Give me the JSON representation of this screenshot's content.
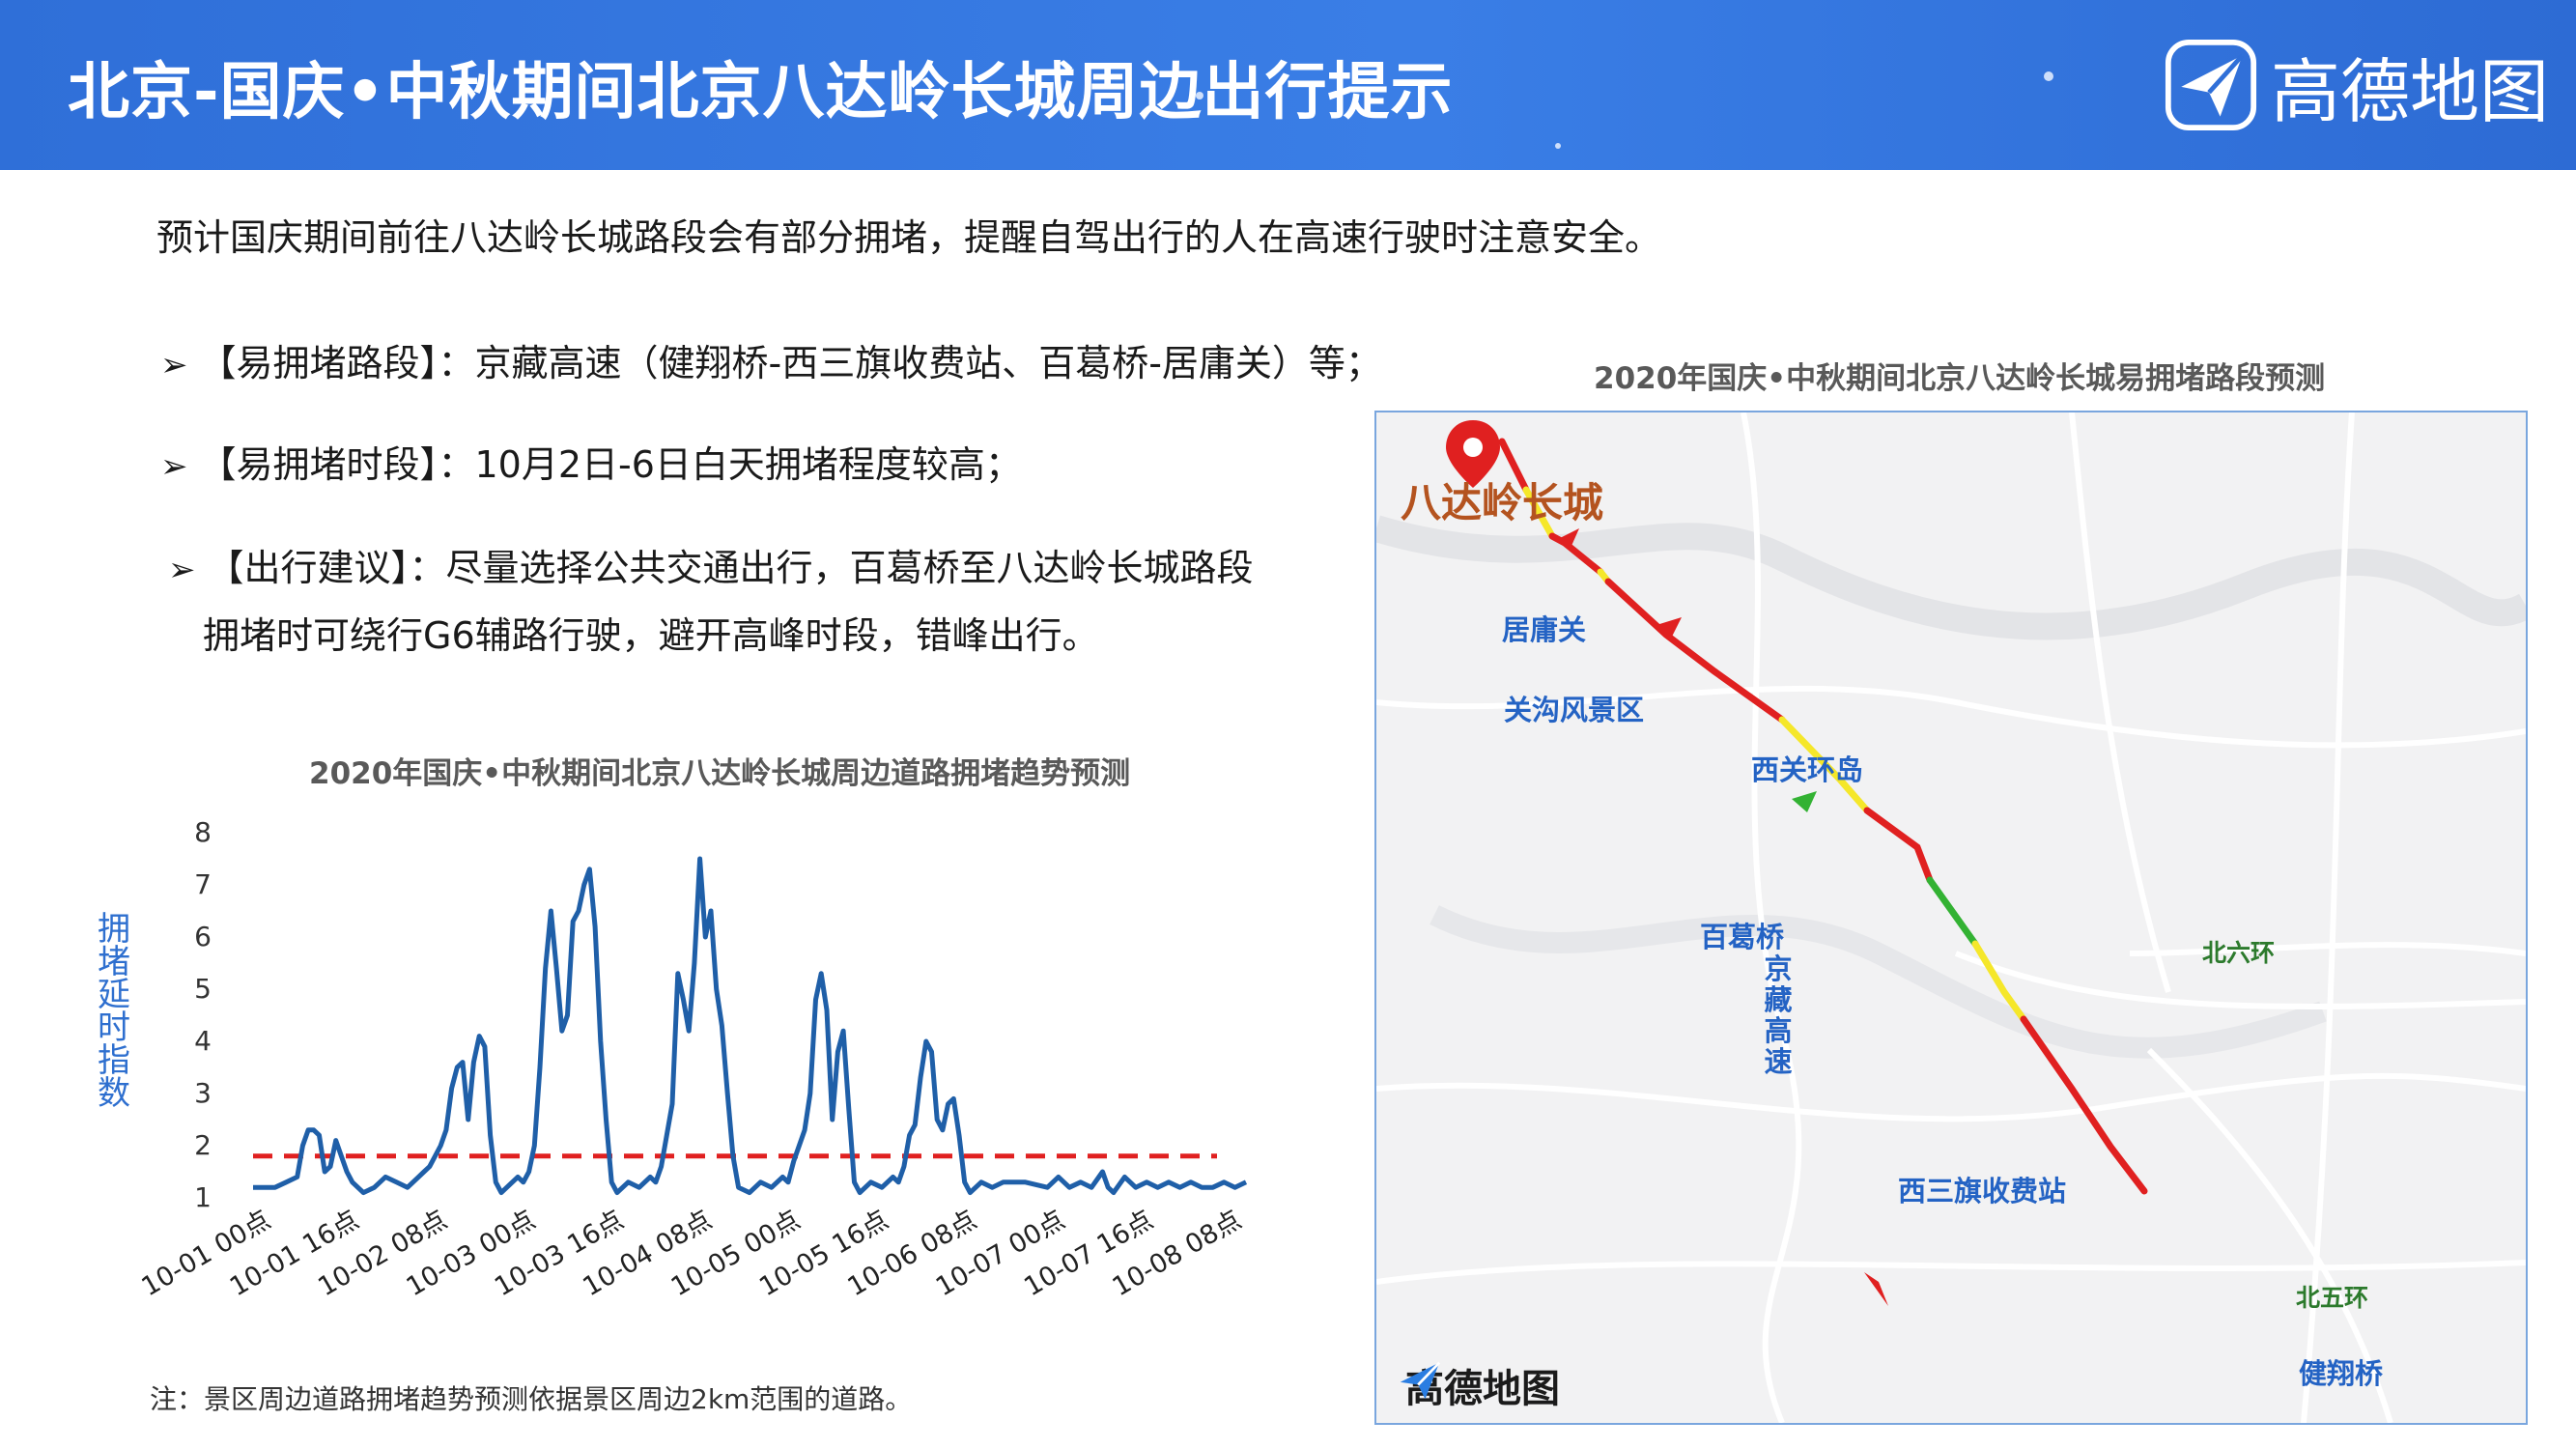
{
  "header": {
    "title": "北京-国庆•中秋期间北京八达岭长城周边出行提示",
    "brand": "高德地图",
    "brand_icon": "gaode-paper-plane-icon"
  },
  "intro": "预计国庆期间前往八达岭长城路段会有部分拥堵，提醒自驾出行的人在高速行驶时注意安全。",
  "bullets": [
    {
      "icon": "arrow-right-icon",
      "text": "【易拥堵路段】：京藏高速（健翔桥-西三旗收费站、百葛桥-居庸关）等；"
    },
    {
      "icon": "arrow-right-icon",
      "text": "【易拥堵时段】：10月2日-6日白天拥堵程度较高；"
    },
    {
      "icon": "arrow-right-icon",
      "text": "【出行建议】：尽量选择公共交通出行，百葛桥至八达岭长城路段",
      "text_cont": "拥堵时可绕行G6辅路行驶，避开高峰时段，错峰出行。"
    }
  ],
  "chart_title": "2020年国庆•中秋期间北京八达岭长城周边道路拥堵趋势预测",
  "chart_ylabel": [
    "拥",
    "堵",
    "延",
    "时",
    "指",
    "数"
  ],
  "chart_data": {
    "type": "line",
    "title": "2020年国庆•中秋期间北京八达岭长城周边道路拥堵趋势预测",
    "ylabel": "拥堵延时指数",
    "xlabel": "",
    "ylim": [
      1,
      8
    ],
    "yticks": [
      1,
      2,
      3,
      4,
      5,
      6,
      7,
      8
    ],
    "xlim": [
      0,
      180
    ],
    "x_tick_labels": [
      "10-01 00点",
      "10-01 16点",
      "10-02 08点",
      "10-03 00点",
      "10-03 16点",
      "10-04 08点",
      "10-05 00点",
      "10-05 16点",
      "10-06 08点",
      "10-07 00点",
      "10-07 16点",
      "10-08 08点"
    ],
    "x_tick_hours": [
      0,
      16,
      32,
      48,
      64,
      80,
      96,
      112,
      128,
      144,
      160,
      176
    ],
    "grid": false,
    "reference_line": {
      "y": 1.8,
      "style": "dashed",
      "color": "#e02020"
    },
    "series": [
      {
        "color": "#1f5fa8",
        "points": [
          [
            0,
            1.2
          ],
          [
            4,
            1.2
          ],
          [
            6,
            1.3
          ],
          [
            8,
            1.4
          ],
          [
            9,
            2.0
          ],
          [
            10,
            2.3
          ],
          [
            11,
            2.3
          ],
          [
            12,
            2.2
          ],
          [
            13,
            1.5
          ],
          [
            14,
            1.6
          ],
          [
            15,
            2.1
          ],
          [
            16,
            1.8
          ],
          [
            17,
            1.5
          ],
          [
            18,
            1.3
          ],
          [
            20,
            1.1
          ],
          [
            22,
            1.2
          ],
          [
            24,
            1.4
          ],
          [
            26,
            1.3
          ],
          [
            28,
            1.2
          ],
          [
            30,
            1.4
          ],
          [
            31,
            1.5
          ],
          [
            32,
            1.6
          ],
          [
            34,
            2.0
          ],
          [
            35,
            2.3
          ],
          [
            36,
            3.1
          ],
          [
            37,
            3.5
          ],
          [
            38,
            3.6
          ],
          [
            39,
            2.5
          ],
          [
            40,
            3.6
          ],
          [
            41,
            4.1
          ],
          [
            42,
            3.9
          ],
          [
            43,
            2.2
          ],
          [
            44,
            1.3
          ],
          [
            45,
            1.1
          ],
          [
            46,
            1.2
          ],
          [
            48,
            1.4
          ],
          [
            49,
            1.3
          ],
          [
            50,
            1.5
          ],
          [
            51,
            2.0
          ],
          [
            52,
            3.5
          ],
          [
            53,
            5.4
          ],
          [
            54,
            6.5
          ],
          [
            55,
            5.4
          ],
          [
            56,
            4.2
          ],
          [
            57,
            4.5
          ],
          [
            58,
            6.3
          ],
          [
            59,
            6.5
          ],
          [
            60,
            7.0
          ],
          [
            61,
            7.3
          ],
          [
            62,
            6.2
          ],
          [
            63,
            4.0
          ],
          [
            64,
            2.5
          ],
          [
            65,
            1.3
          ],
          [
            66,
            1.1
          ],
          [
            68,
            1.3
          ],
          [
            70,
            1.2
          ],
          [
            72,
            1.4
          ],
          [
            73,
            1.3
          ],
          [
            74,
            1.6
          ],
          [
            75,
            2.2
          ],
          [
            76,
            2.8
          ],
          [
            77,
            5.3
          ],
          [
            78,
            4.8
          ],
          [
            79,
            4.2
          ],
          [
            80,
            5.5
          ],
          [
            81,
            7.5
          ],
          [
            82,
            6.0
          ],
          [
            83,
            6.5
          ],
          [
            84,
            5.0
          ],
          [
            85,
            4.3
          ],
          [
            86,
            3.0
          ],
          [
            87,
            1.8
          ],
          [
            88,
            1.2
          ],
          [
            90,
            1.1
          ],
          [
            92,
            1.3
          ],
          [
            94,
            1.2
          ],
          [
            96,
            1.4
          ],
          [
            97,
            1.3
          ],
          [
            98,
            1.7
          ],
          [
            99,
            2.0
          ],
          [
            100,
            2.3
          ],
          [
            101,
            3.0
          ],
          [
            102,
            4.8
          ],
          [
            103,
            5.3
          ],
          [
            104,
            4.6
          ],
          [
            105,
            2.5
          ],
          [
            106,
            3.8
          ],
          [
            107,
            4.2
          ],
          [
            108,
            2.7
          ],
          [
            109,
            1.3
          ],
          [
            110,
            1.1
          ],
          [
            112,
            1.3
          ],
          [
            114,
            1.2
          ],
          [
            116,
            1.4
          ],
          [
            117,
            1.3
          ],
          [
            118,
            1.6
          ],
          [
            119,
            2.2
          ],
          [
            120,
            2.4
          ],
          [
            121,
            3.3
          ],
          [
            122,
            4.0
          ],
          [
            123,
            3.8
          ],
          [
            124,
            2.5
          ],
          [
            125,
            2.3
          ],
          [
            126,
            2.8
          ],
          [
            127,
            2.9
          ],
          [
            128,
            2.2
          ],
          [
            129,
            1.3
          ],
          [
            130,
            1.1
          ],
          [
            132,
            1.3
          ],
          [
            134,
            1.2
          ],
          [
            136,
            1.3
          ],
          [
            140,
            1.3
          ],
          [
            144,
            1.2
          ],
          [
            146,
            1.4
          ],
          [
            148,
            1.2
          ],
          [
            150,
            1.3
          ],
          [
            152,
            1.2
          ],
          [
            154,
            1.5
          ],
          [
            155,
            1.2
          ],
          [
            156,
            1.1
          ],
          [
            158,
            1.4
          ],
          [
            159,
            1.3
          ],
          [
            160,
            1.2
          ],
          [
            162,
            1.3
          ],
          [
            164,
            1.2
          ],
          [
            166,
            1.3
          ],
          [
            168,
            1.2
          ],
          [
            170,
            1.3
          ],
          [
            172,
            1.2
          ],
          [
            174,
            1.2
          ],
          [
            176,
            1.3
          ],
          [
            178,
            1.2
          ],
          [
            180,
            1.3
          ]
        ]
      }
    ]
  },
  "note": "注：景区周边道路拥堵趋势预测依据景区周边2km范围的道路。",
  "map": {
    "title": "2020年国庆•中秋期间北京八达岭长城易拥堵路段预测",
    "brand": "高德地图",
    "labels": {
      "badaling": "八达岭长城",
      "juyongguan": "居庸关",
      "guangou": "关沟风景区",
      "xiguanhuandao": "西关环岛",
      "baigeqiao": "百葛桥",
      "jingzang": [
        "京",
        "藏",
        "高",
        "速"
      ],
      "beiliuhuan": "北六环",
      "xisanqi": "西三旗收费站",
      "beiwuhuan": "北五环",
      "jianxiangqiao": "健翔桥"
    },
    "colors": {
      "congested": "#e02020",
      "slow": "#f5e72a",
      "smooth": "#33b233",
      "pin": "#e02020"
    }
  }
}
